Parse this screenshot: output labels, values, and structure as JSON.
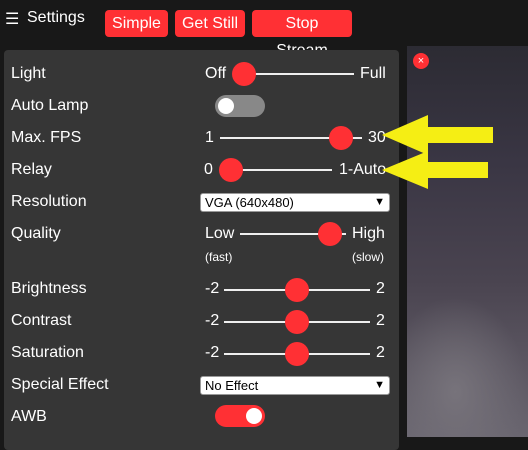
{
  "header": {
    "menu_glyph": "☰",
    "title": "Settings",
    "buttons": [
      {
        "label": "Simple"
      },
      {
        "label": "Get Still"
      },
      {
        "label": "Stop Stream"
      }
    ]
  },
  "colors": {
    "accent": "#ff3034",
    "panel": "#363636",
    "background": "#181818"
  },
  "settings": {
    "light": {
      "label": "Light",
      "min": "Off",
      "max": "Full",
      "level": 0.0
    },
    "auto_lamp": {
      "label": "Auto Lamp",
      "checked": false
    },
    "max_fps": {
      "label": "Max. FPS",
      "min": "1",
      "max": "30",
      "level": 0.85
    },
    "relay": {
      "label": "Relay",
      "min": "0",
      "max": "1-Auto",
      "level": 0.0
    },
    "resolution": {
      "label": "Resolution",
      "value": "VGA (640x480)"
    },
    "quality": {
      "label": "Quality",
      "min": "Low",
      "max": "High",
      "min_note": "(fast)",
      "max_note": "(slow)",
      "level": 1.0
    },
    "brightness": {
      "label": "Brightness",
      "min": "-2",
      "max": "2",
      "value": 0
    },
    "contrast": {
      "label": "Contrast",
      "min": "-2",
      "max": "2",
      "value": 0
    },
    "saturation": {
      "label": "Saturation",
      "min": "-2",
      "max": "2",
      "value": 0
    },
    "special_effect": {
      "label": "Special Effect",
      "value": "No Effect"
    },
    "awb": {
      "label": "AWB",
      "checked": true
    }
  },
  "stream": {
    "close_glyph": "×"
  }
}
